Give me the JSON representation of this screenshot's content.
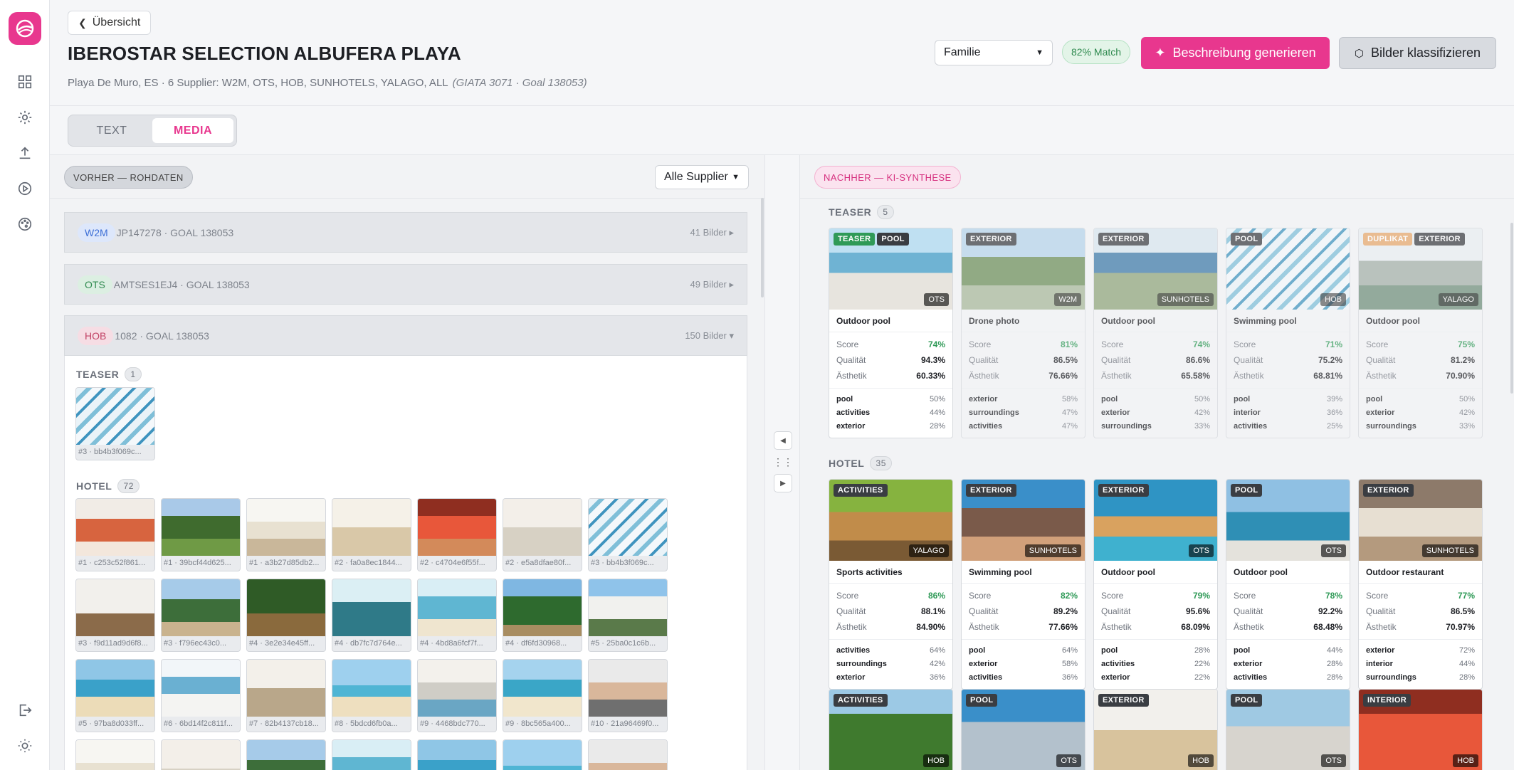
{
  "nav": {
    "back_label": "Übersicht"
  },
  "hotel": {
    "title": "IBEROSTAR SELECTION ALBUFERA PLAYA",
    "subtitle": "Playa De Muro, ES · 6 Supplier: W2M, OTS, HOB, SUNHOTELS, YALAGO, ALL",
    "ids": "(GIATA 3071 · Goal 138053)"
  },
  "controls": {
    "audience": "Familie",
    "match": "82% Match",
    "generate_label": "Beschreibung generieren",
    "classify_label": "Bilder klassifizieren"
  },
  "tabs": [
    {
      "label": "TEXT"
    },
    {
      "label": "MEDIA"
    }
  ],
  "left": {
    "title": "VORHER — ROHDATEN",
    "filter": "Alle Supplier",
    "suppliers": [
      {
        "tag": "W2M",
        "info": "JP147278 · GOAL 138053",
        "count": "41 Bilder ▸"
      },
      {
        "tag": "OTS",
        "info": "AMTSES1EJ4 · GOAL 138053",
        "count": "49 Bilder ▸"
      },
      {
        "tag": "HOB",
        "info": "1082 · GOAL 138053",
        "count": "150 Bilder ▾"
      }
    ],
    "teaser": {
      "label": "TEASER",
      "count": "1",
      "items": [
        {
          "caption": "#3 · bb4b3f069c..."
        }
      ]
    },
    "hotel": {
      "label": "HOTEL",
      "count": "72",
      "items": [
        {
          "caption": "#1 · c253c52f861..."
        },
        {
          "caption": "#1 · 39bcf44d625..."
        },
        {
          "caption": "#1 · a3b27d85db2..."
        },
        {
          "caption": "#2 · fa0a8ec1844..."
        },
        {
          "caption": "#2 · c4704e6f55f..."
        },
        {
          "caption": "#2 · e5a8dfae80f..."
        },
        {
          "caption": "#3 · bb4b3f069c..."
        },
        {
          "caption": "#3 · f9d11ad9d6f8..."
        },
        {
          "caption": "#3 · f796ec43c0..."
        },
        {
          "caption": "#4 · 3e2e34e45ff..."
        },
        {
          "caption": "#4 · db7fc7d764e..."
        },
        {
          "caption": "#4 · 4bd8a6fcf7f..."
        },
        {
          "caption": "#4 · df6fd30968..."
        },
        {
          "caption": "#5 · 25ba0c1c6b..."
        },
        {
          "caption": "#5 · 97ba8d033ff..."
        },
        {
          "caption": "#6 · 6bd14f2c811f..."
        },
        {
          "caption": "#7 · 82b4137cb18..."
        },
        {
          "caption": "#8 · 5bdcd6fb0a..."
        },
        {
          "caption": "#9 · 4468bdc770..."
        },
        {
          "caption": "#9 · 8bc565a400..."
        },
        {
          "caption": "#10 · 21a96469f0..."
        }
      ]
    }
  },
  "right": {
    "title": "NACHHER — KI-SYNTHESE",
    "teaser": {
      "label": "TEASER",
      "count": "5",
      "cards": [
        {
          "labels": [
            "TEASER",
            "POOL"
          ],
          "supplier": "OTS",
          "name": "Outdoor pool",
          "score": "74%",
          "quality": "94.3%",
          "aesthetic": "60.33%",
          "tags": [
            [
              "pool",
              "50%"
            ],
            [
              "activities",
              "44%"
            ],
            [
              "exterior",
              "28%"
            ]
          ]
        },
        {
          "labels": [
            "EXTERIOR"
          ],
          "supplier": "W2M",
          "name": "Drone photo",
          "score": "81%",
          "quality": "86.5%",
          "aesthetic": "76.66%",
          "tags": [
            [
              "exterior",
              "58%"
            ],
            [
              "surroundings",
              "47%"
            ],
            [
              "activities",
              "47%"
            ]
          ]
        },
        {
          "labels": [
            "EXTERIOR"
          ],
          "supplier": "SUNHOTELS",
          "name": "Outdoor pool",
          "score": "74%",
          "quality": "86.6%",
          "aesthetic": "65.58%",
          "tags": [
            [
              "pool",
              "50%"
            ],
            [
              "exterior",
              "42%"
            ],
            [
              "surroundings",
              "33%"
            ]
          ]
        },
        {
          "labels": [
            "POOL"
          ],
          "supplier": "HOB",
          "name": "Swimming pool",
          "score": "71%",
          "quality": "75.2%",
          "aesthetic": "68.81%",
          "tags": [
            [
              "pool",
              "39%"
            ],
            [
              "interior",
              "36%"
            ],
            [
              "activities",
              "25%"
            ]
          ]
        },
        {
          "labels": [
            "DUPLIKAT",
            "EXTERIOR"
          ],
          "supplier": "YALAGO",
          "name": "Outdoor pool",
          "score": "75%",
          "quality": "81.2%",
          "aesthetic": "70.90%",
          "tags": [
            [
              "pool",
              "50%"
            ],
            [
              "exterior",
              "42%"
            ],
            [
              "surroundings",
              "33%"
            ]
          ]
        }
      ]
    },
    "hotel": {
      "label": "HOTEL",
      "count": "35",
      "cards": [
        {
          "labels": [
            "ACTIVITIES"
          ],
          "supplier": "YALAGO",
          "name": "Sports activities",
          "score": "86%",
          "quality": "88.1%",
          "aesthetic": "84.90%",
          "tags": [
            [
              "activities",
              "64%"
            ],
            [
              "surroundings",
              "42%"
            ],
            [
              "exterior",
              "36%"
            ]
          ]
        },
        {
          "labels": [
            "EXTERIOR"
          ],
          "supplier": "SUNHOTELS",
          "name": "Swimming pool",
          "score": "82%",
          "quality": "89.2%",
          "aesthetic": "77.66%",
          "tags": [
            [
              "pool",
              "64%"
            ],
            [
              "exterior",
              "58%"
            ],
            [
              "activities",
              "36%"
            ]
          ]
        },
        {
          "labels": [
            "EXTERIOR"
          ],
          "supplier": "OTS",
          "name": "Outdoor pool",
          "score": "79%",
          "quality": "95.6%",
          "aesthetic": "68.09%",
          "tags": [
            [
              "pool",
              "28%"
            ],
            [
              "activities",
              "22%"
            ],
            [
              "exterior",
              "22%"
            ]
          ]
        },
        {
          "labels": [
            "POOL"
          ],
          "supplier": "OTS",
          "name": "Outdoor pool",
          "score": "78%",
          "quality": "92.2%",
          "aesthetic": "68.48%",
          "tags": [
            [
              "pool",
              "44%"
            ],
            [
              "exterior",
              "28%"
            ],
            [
              "activities",
              "28%"
            ]
          ]
        },
        {
          "labels": [
            "EXTERIOR"
          ],
          "supplier": "SUNHOTELS",
          "name": "Outdoor restaurant",
          "score": "77%",
          "quality": "86.5%",
          "aesthetic": "70.97%",
          "tags": [
            [
              "exterior",
              "72%"
            ],
            [
              "interior",
              "44%"
            ],
            [
              "surroundings",
              "28%"
            ]
          ]
        }
      ],
      "cards2": [
        {
          "labels": [
            "ACTIVITIES"
          ],
          "supplier": "HOB"
        },
        {
          "labels": [
            "POOL"
          ],
          "supplier": "OTS"
        },
        {
          "labels": [
            "EXTERIOR"
          ],
          "supplier": "HOB"
        },
        {
          "labels": [
            "POOL"
          ],
          "supplier": "OTS"
        },
        {
          "labels": [
            "INTERIOR"
          ],
          "supplier": "HOB"
        }
      ]
    },
    "metric_labels": {
      "score": "Score",
      "quality": "Qualität",
      "aesthetic": "Ästhetik"
    }
  },
  "colors": {
    "accent": "#e8378e",
    "label_teaser": "#2f9a57",
    "label_dark": "#3a3d42",
    "label_dup": "#e6a86b",
    "score_green": "#2f9a57"
  }
}
